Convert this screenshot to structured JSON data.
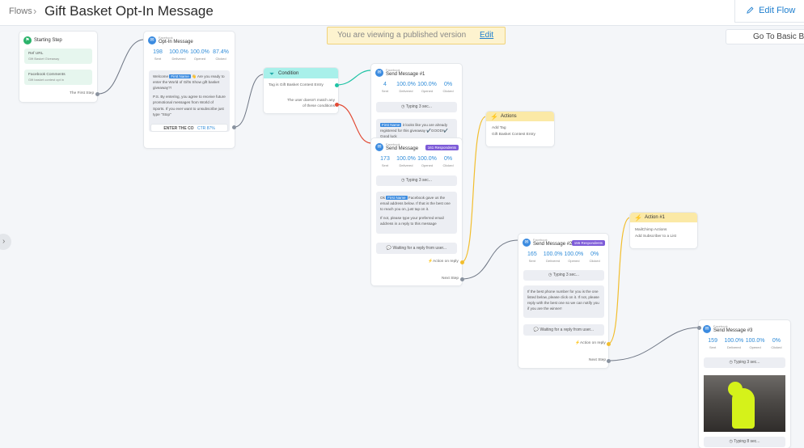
{
  "breadcrumb": {
    "root": "Flows",
    "separator": "›"
  },
  "title": "Gift Basket Opt-In Message",
  "topbar": {
    "edit_flow": "Edit Flow",
    "basic_builder": "Go To Basic Builder"
  },
  "banner": {
    "text": "You are viewing a published version",
    "edit": "Edit"
  },
  "icons": {
    "pencil": "pencil-icon",
    "messenger": "messenger-icon",
    "flag": "flag-icon",
    "funnel": "funnel-icon",
    "bolt": "bolt-icon",
    "clock": "clock-icon",
    "speech": "speech-bubble-icon",
    "chevron": "chevron-right-icon"
  },
  "colors": {
    "accent": "#1f7fcf",
    "stat": "#2e8bd8",
    "respondents": "#7d5bd8",
    "wire_green": "#1fc3a5",
    "wire_red": "#e24b35",
    "wire_yellow": "#f2be2e"
  },
  "start": {
    "title": "Starting Step",
    "items": [
      {
        "name": "Ref URL",
        "sub": "Gift Basket Giveaway"
      },
      {
        "name": "Facebook Comments",
        "sub": "Gift basket contest opt in"
      }
    ],
    "footer": "The First Step"
  },
  "optin": {
    "platform": "Facebook",
    "title": "Opt-In Message",
    "stats": [
      {
        "value": "198",
        "label": "Sent"
      },
      {
        "value": "100.0%",
        "label": "Delivered"
      },
      {
        "value": "100.0%",
        "label": "Opened"
      },
      {
        "value": "87.4%",
        "label": "Clicked"
      }
    ],
    "msg_pre": "Welcome",
    "msg_tag": "First Name",
    "msg_body": "👋 Are you ready to enter the World of Gifts Show gift basket giveaway?!",
    "msg_body2": "P.S. By entering, you agree to receive future promotional messages from World of Sports. If you ever want to unsubscribe just type \"Stop\"",
    "button": "ENTER THE CO",
    "button_ctr": "CTR 87%"
  },
  "condition": {
    "title": "Condition",
    "rule": "Tag is Gift Basket Contest Entry",
    "else": "The user doesn't match any of these conditions"
  },
  "send1": {
    "platform": "Facebook",
    "title": "Send Message #1",
    "stats": [
      {
        "value": "4",
        "label": "Sent"
      },
      {
        "value": "100.0%",
        "label": "Delivered"
      },
      {
        "value": "100.0%",
        "label": "Opened"
      },
      {
        "value": "0%",
        "label": "Clicked"
      }
    ],
    "typing": "Typing 3 sec...",
    "msg_tag": "First Name",
    "msg": "it looks like you are already registered for this giveaway ✔️GOOD!✔️ Good luck"
  },
  "send2": {
    "platform": "Facebook",
    "title": "Send Message",
    "respondents": "161 Respondents",
    "stats": [
      {
        "value": "173",
        "label": "Sent"
      },
      {
        "value": "100.0%",
        "label": "Delivered"
      },
      {
        "value": "100.0%",
        "label": "Opened"
      },
      {
        "value": "0%",
        "label": "Clicked"
      }
    ],
    "typing": "Typing 3 sec...",
    "msg_pre": "Ok",
    "msg_tag": "First Name",
    "msg_body": "Facebook gave us the email address below. If that is the best one to reach you on, just tap on it.",
    "msg_body2": "If not, please type your preferred email address in a reply to this message",
    "waiting": "Waiting for a reply from user...",
    "action": "Action on reply",
    "next": "Next Step"
  },
  "actions1": {
    "title": "Actions",
    "line1": "Add Tag",
    "line2": "Gift Basket Contest Entry"
  },
  "actions2": {
    "title": "Action #1",
    "line1": "MailChimp Actions",
    "line2": "Add Subscriber to a List"
  },
  "send3": {
    "platform": "Facebook",
    "title": "Send Message #2",
    "respondents": "155 Respondents",
    "stats": [
      {
        "value": "165",
        "label": "Sent"
      },
      {
        "value": "100.0%",
        "label": "Delivered"
      },
      {
        "value": "100.0%",
        "label": "Opened"
      },
      {
        "value": "0%",
        "label": "Clicked"
      }
    ],
    "typing": "Typing 3 sec...",
    "msg": "If the best phone number for you is the one listed below, please click on it. If not, please reply with the best one so we can notify you if you are the winner!",
    "waiting": "Waiting for a reply from user...",
    "action": "Action on reply",
    "next": "Next Step"
  },
  "send4": {
    "platform": "Facebook",
    "title": "Send Message #3",
    "stats": [
      {
        "value": "159",
        "label": "Sent"
      },
      {
        "value": "100.0%",
        "label": "Delivered"
      },
      {
        "value": "100.0%",
        "label": "Opened"
      },
      {
        "value": "0%",
        "label": "Clicked"
      }
    ],
    "typing1": "Typing 3 sec...",
    "typing2": "Typing 8 sec..."
  }
}
